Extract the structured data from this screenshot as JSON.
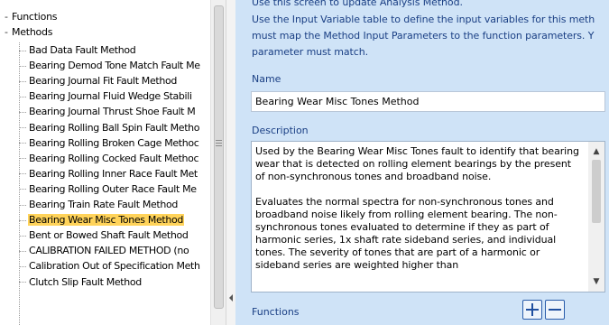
{
  "tree": {
    "root_label": "Functions",
    "methods_label": "Methods",
    "items": [
      "Bad Data Fault Method",
      "Bearing Demod Tone Match Fault Me",
      "Bearing Journal Fit Fault Method",
      "Bearing Journal Fluid Wedge Stabili",
      "Bearing Journal Thrust Shoe Fault M",
      "Bearing Rolling Ball Spin Fault Metho",
      "Bearing Rolling Broken Cage Methoc",
      "Bearing Rolling Cocked Fault Methoc",
      "Bearing Rolling Inner Race Fault Met",
      "Bearing Rolling Outer Race Fault Me",
      "Bearing Train Rate Fault Method",
      "Bearing Wear Misc Tones Method",
      "Bent or Bowed Shaft Fault Method",
      "CALIBRATION FAILED METHOD (no",
      "Calibration Out of Specification Meth",
      "Clutch Slip Fault Method"
    ],
    "selected_index": 11
  },
  "panel": {
    "intro_line0": "Use this screen to update Analysis Method.",
    "intro_line1": "Use the Input Variable table to define the input variables for this meth",
    "intro_line2": "must map the Method Input Parameters to the function parameters. Y",
    "intro_line3": "parameter must match.",
    "name_label": "Name",
    "name_value": "Bearing Wear Misc Tones Method",
    "description_label": "Description",
    "description_text": "Used by the Bearing Wear Misc Tones fault to identify that bearing wear that is detected on rolling element bearings by the present of non-synchronous tones and broadband noise.\n\nEvaluates the normal spectra for non-synchronous tones and broadband noise likely from rolling element bearing. The non-synchronous tones evaluated to determine if they as part of harmonic series, 1x shaft rate sideband series, and individual tones. The severity of tones that are part of a harmonic or sideband series are weighted higher than",
    "functions_label": "Functions",
    "colors": {
      "panel_bg": "#cfe3f7",
      "label_text": "#1a3f84",
      "selected_bg": "#ffd35a"
    }
  }
}
